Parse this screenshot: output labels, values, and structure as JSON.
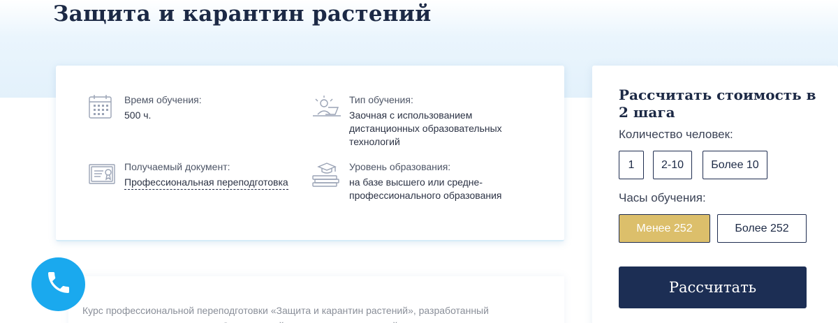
{
  "page": {
    "title": "Защита и карантин растений"
  },
  "info": [
    {
      "icon": "calendar-icon",
      "label": "Время обучения:",
      "value": "500 ч."
    },
    {
      "icon": "student-laptop-icon",
      "label": "Тип обучения:",
      "value": "Заочная с использованием дистанционных образовательных технологий"
    },
    {
      "icon": "certificate-icon",
      "label": "Получаемый документ:",
      "value": "Профессиональная переподготовка"
    },
    {
      "icon": "graduation-books-icon",
      "label": "Уровень образования:",
      "value": "на базе высшего или средне-профессионального образования"
    }
  ],
  "description": "Курс профессиональной переподготовки «Защита и карантин растений», разработанный преподавателями-практиками Современной научно-технологической академии, предназначен для",
  "calculator": {
    "title": "Рассчитать стоимость в 2 шага",
    "people_label": "Количество человек:",
    "people_options": [
      "1",
      "2-10",
      "Более 10"
    ],
    "hours_label": "Часы обучения:",
    "hours_options": [
      "Менее 252",
      "Более 252"
    ],
    "hours_selected": "Менее 252",
    "submit_label": "Рассчитать"
  },
  "colors": {
    "accent_gold": "#dcbf6b",
    "navy": "#1c2e54",
    "phone_blue": "#1aa9ee"
  },
  "icons": {
    "phone": "phone-icon"
  }
}
